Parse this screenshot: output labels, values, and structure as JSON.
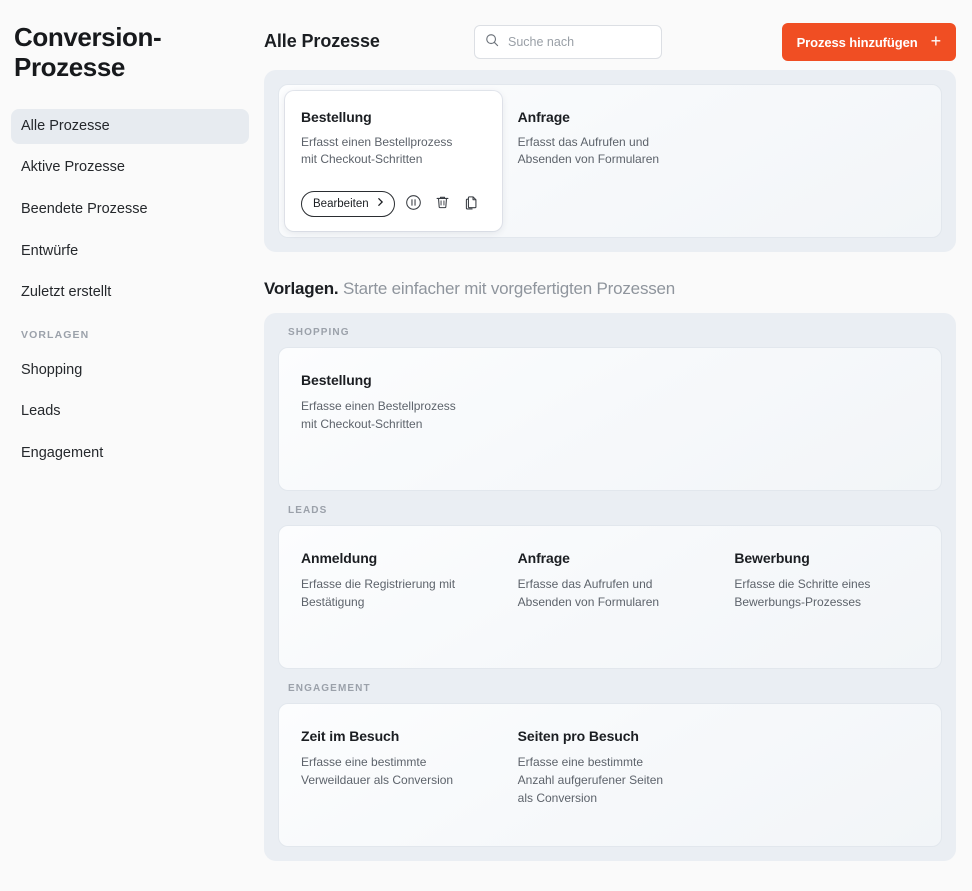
{
  "app": {
    "title": "Conversion-Prozesse"
  },
  "sidebar": {
    "items": [
      {
        "label": "Alle Prozesse",
        "active": true
      },
      {
        "label": "Aktive Prozesse",
        "active": false
      },
      {
        "label": "Beendete Prozesse",
        "active": false
      },
      {
        "label": "Entwürfe",
        "active": false
      },
      {
        "label": "Zuletzt erstellt",
        "active": false
      }
    ],
    "section_label": "VORLAGEN",
    "template_items": [
      {
        "label": "Shopping"
      },
      {
        "label": "Leads"
      },
      {
        "label": "Engagement"
      }
    ]
  },
  "topbar": {
    "heading": "Alle Prozesse",
    "search_placeholder": "Suche nach",
    "search_value": "",
    "search_icon": "search-icon",
    "add_button_label": "Prozess hinzufügen",
    "add_button_icon": "plus-icon",
    "accent_color": "#F04E23"
  },
  "processes": {
    "items": [
      {
        "title": "Bestellung",
        "description": "Erfasst einen Bestellprozess mit Checkout-Schritten",
        "hovered": true,
        "actions": {
          "edit_label": "Bearbeiten",
          "edit_icon": "chevron-right-icon",
          "pause_icon": "pause-circle-icon",
          "delete_icon": "trash-icon",
          "duplicate_icon": "copy-icon"
        }
      },
      {
        "title": "Anfrage",
        "description": "Erfasst das Aufrufen und Absenden von Formularen",
        "hovered": false
      }
    ]
  },
  "templates": {
    "heading_strong": "Vorlagen.",
    "heading_muted": "Starte einfacher mit vorgefertigten Prozessen",
    "sections": [
      {
        "label": "SHOPPING",
        "items": [
          {
            "title": "Bestellung",
            "description": "Erfasse einen Bestellprozess mit Checkout-Schritten"
          }
        ]
      },
      {
        "label": "LEADS",
        "items": [
          {
            "title": "Anmeldung",
            "description": "Erfasse die Registrierung mit Bestätigung"
          },
          {
            "title": "Anfrage",
            "description": "Erfasse das Aufrufen und Absenden von Formularen"
          },
          {
            "title": "Bewerbung",
            "description": "Erfasse die Schritte eines Bewerbungs-Prozesses"
          }
        ]
      },
      {
        "label": "ENGAGEMENT",
        "items": [
          {
            "title": "Zeit im Besuch",
            "description": "Erfasse eine bestimmte Verweildauer als Conversion"
          },
          {
            "title": "Seiten pro Besuch",
            "description": "Erfasse eine bestimmte Anzahl aufgerufener Seiten als Conversion"
          }
        ]
      }
    ]
  }
}
